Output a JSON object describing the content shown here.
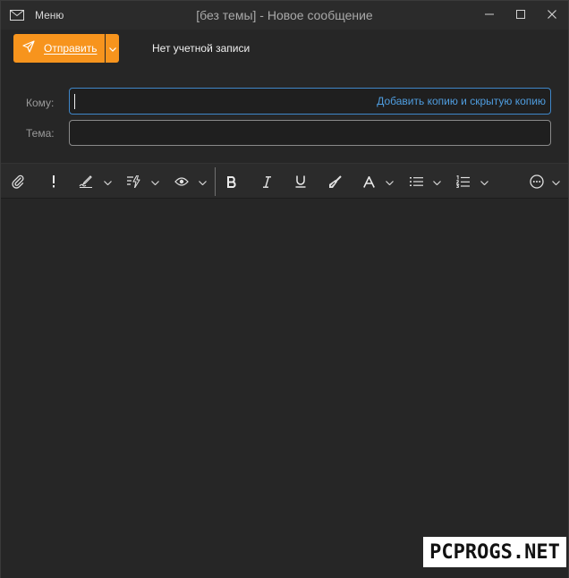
{
  "titlebar": {
    "menu_label": "Меню",
    "title": "[без темы] - Новое сообщение",
    "icons": [
      "mail-icon",
      "minimize-icon",
      "maximize-icon",
      "close-icon"
    ]
  },
  "compose": {
    "send_label": "Отправить",
    "account_label": "Нет учетной записи",
    "to_label": "Кому:",
    "to_value": "",
    "cc_bcc_link": "Добавить копию и скрытую копию",
    "subject_label": "Тема:",
    "subject_value": ""
  },
  "toolbar": {
    "tools": [
      "attach-icon",
      "importance-icon",
      "signature-icon",
      "quick-text-icon",
      "view-icon",
      "bold-icon",
      "italic-icon",
      "underline-icon",
      "format-painter-icon",
      "font-icon",
      "bullet-list-icon",
      "numbered-list-icon",
      "more-icon"
    ]
  },
  "colors": {
    "accent": "#f7941d",
    "link": "#4f9ddf",
    "focus_border": "#3f87c9",
    "background": "#262626"
  },
  "watermark": {
    "text": "PCPROGS.NET"
  }
}
